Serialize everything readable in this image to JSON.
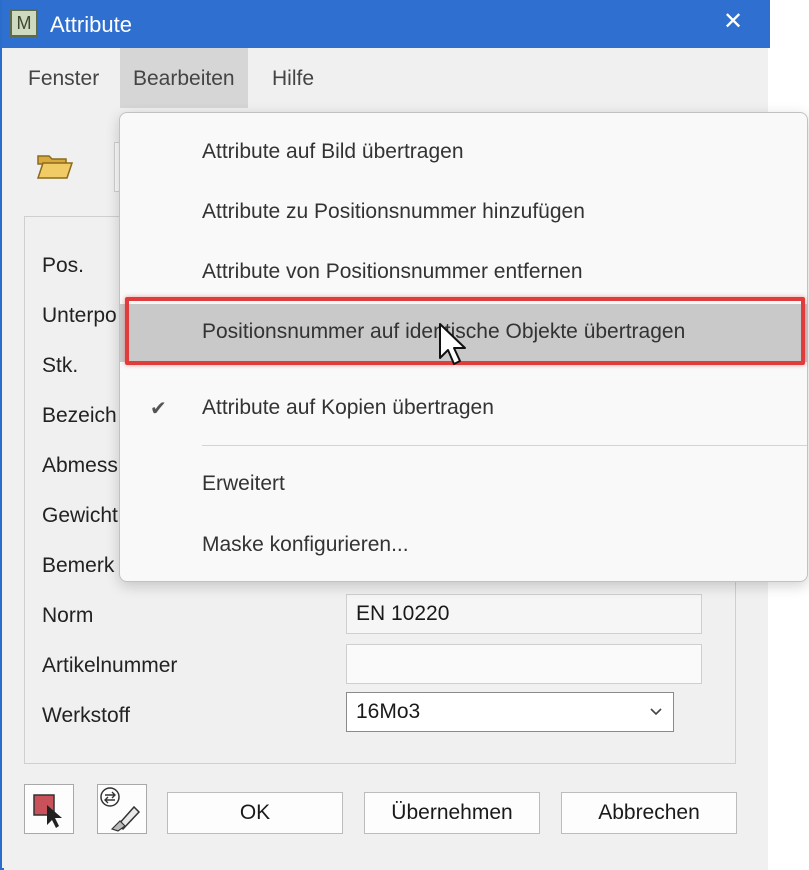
{
  "window": {
    "title": "Attribute",
    "app_icon_letter": "M",
    "close_glyph": "✕"
  },
  "menubar": {
    "items": [
      {
        "label": "Fenster"
      },
      {
        "label": "Bearbeiten",
        "active": true
      },
      {
        "label": "Hilfe"
      }
    ]
  },
  "form": {
    "rows": [
      {
        "label": "Pos."
      },
      {
        "label": "Unterpo"
      },
      {
        "label": "Stk."
      },
      {
        "label": "Bezeich"
      },
      {
        "label": "Abmess"
      },
      {
        "label": "Gewicht"
      },
      {
        "label": "Bemerk"
      },
      {
        "label": "Norm",
        "value": "EN 10220"
      },
      {
        "label": "Artikelnummer",
        "value": ""
      },
      {
        "label": "Werkstoff",
        "value": "16Mo3",
        "type": "select"
      }
    ]
  },
  "buttons": {
    "ok": "OK",
    "apply": "Übernehmen",
    "cancel": "Abbrechen"
  },
  "dropdown": {
    "items": [
      {
        "label": "Attribute auf Bild übertragen"
      },
      {
        "label": "Attribute zu Positionsnummer hinzufügen"
      },
      {
        "label": "Attribute von Positionsnummer entfernen"
      },
      {
        "label": "Positionsnummer auf identische Objekte übertragen",
        "highlighted": true
      },
      {
        "label": "Attribute auf Kopien übertragen",
        "checked": true
      },
      {
        "label": "Erweitert"
      },
      {
        "label": "Maske konfigurieren..."
      }
    ],
    "check_glyph": "✔"
  },
  "colors": {
    "titlebar": "#2f6fd0",
    "highlight_frame": "#e03c3c"
  },
  "icons": {
    "folder": "folder-open-icon",
    "pick": "pick-attributes-icon",
    "transfer": "transfer-attributes-icon",
    "chevron": "chevron-down-icon",
    "cursor": "mouse-cursor-icon"
  }
}
